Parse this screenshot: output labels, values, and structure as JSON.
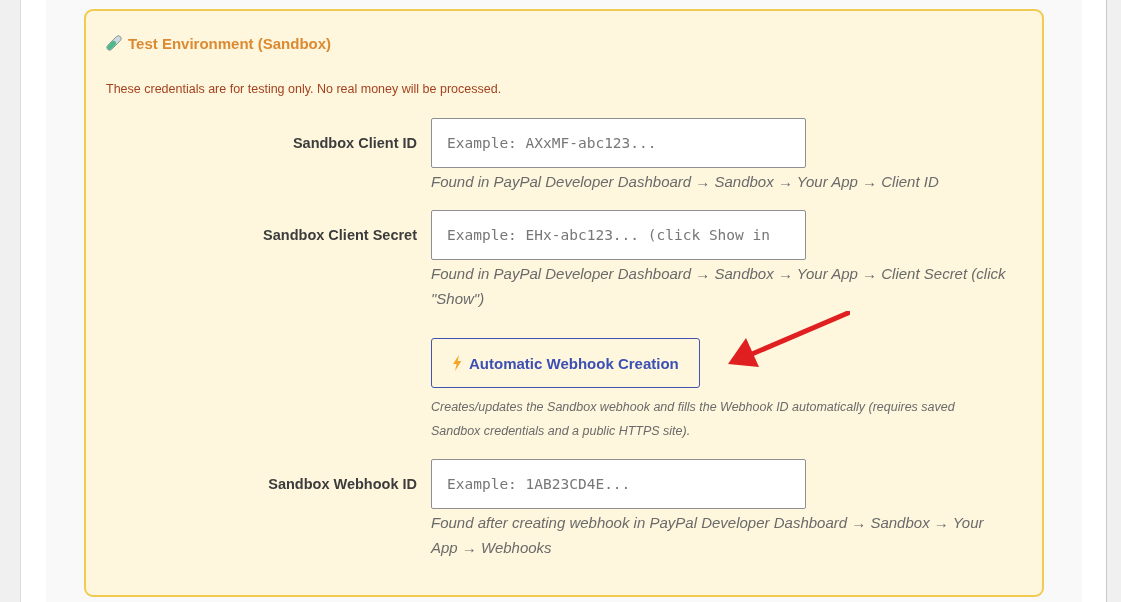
{
  "section": {
    "title": "Test Environment (Sandbox)",
    "notice": "These credentials are for testing only. No real money will be processed.",
    "fields": [
      {
        "kind": "input",
        "label": "Sandbox Client ID",
        "placeholder": "Example: AXxMF-abc123...",
        "help": "Found in PayPal Developer Dashboard → Sandbox → Your App → Client ID"
      },
      {
        "kind": "input",
        "label": "Sandbox Client Secret",
        "placeholder": "Example: EHx-abc123... (click Show in",
        "help": "Found in PayPal Developer Dashboard → Sandbox → Your App → Client Secret (click \"Show\")"
      },
      {
        "kind": "button",
        "label": "Automatic Webhook Creation",
        "help": "Creates/updates the Sandbox webhook and fills the Webhook ID automatically (requires saved Sandbox credentials and a public HTTPS site)."
      },
      {
        "kind": "input",
        "label": "Sandbox Webhook ID",
        "placeholder": "Example: 1AB23CD4E...",
        "help": "Found after creating webhook in PayPal Developer Dashboard → Sandbox → Your App → Webhooks"
      }
    ]
  }
}
